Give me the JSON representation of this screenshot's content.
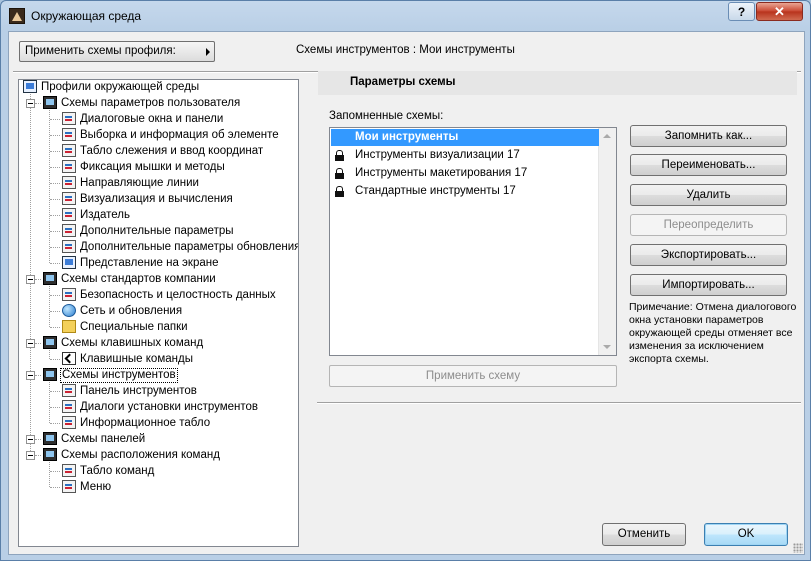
{
  "window": {
    "title": "Окружающая среда",
    "help_label": "?",
    "close_label": "✕"
  },
  "header": {
    "profile_button": "Применить схемы профиля:",
    "current_label": "Схемы инструментов : Мои инструменты"
  },
  "tree": {
    "root": "Профили окружающей среды",
    "groups": [
      {
        "label": "Схемы параметров пользователя",
        "children": [
          "Диалоговые окна и панели",
          "Выборка и информация об элементе",
          "Табло слежения и ввод координат",
          "Фиксация мышки и методы",
          "Направляющие линии",
          "Визуализация и вычисления",
          "Издатель",
          "Дополнительные параметры",
          "Дополнительные параметры обновления",
          "Представление на экране"
        ]
      },
      {
        "label": "Схемы стандартов компании",
        "children": [
          "Безопасность и целостность данных",
          "Сеть и обновления",
          "Специальные папки"
        ]
      },
      {
        "label": "Схемы клавишных команд",
        "children": [
          "Клавишные команды"
        ]
      },
      {
        "label": "Схемы инструментов",
        "children": [
          "Панель инструментов",
          "Диалоги установки инструментов",
          "Информационное табло"
        ]
      },
      {
        "label": "Схемы панелей",
        "children": []
      },
      {
        "label": "Схемы расположения команд",
        "children": [
          "Табло команд",
          "Меню"
        ]
      }
    ],
    "selected": "Схемы инструментов"
  },
  "panel": {
    "heading": "Параметры схемы",
    "saved_label": "Запомненные схемы:",
    "schemes": [
      {
        "label": "Мои инструменты",
        "locked": false,
        "selected": true
      },
      {
        "label": "Инструменты визуализации 17",
        "locked": true,
        "selected": false
      },
      {
        "label": "Инструменты макетирования 17",
        "locked": true,
        "selected": false
      },
      {
        "label": "Стандартные инструменты 17",
        "locked": true,
        "selected": false
      }
    ],
    "apply_button": "Применить схему",
    "buttons": {
      "save_as": "Запомнить как...",
      "rename": "Переименовать...",
      "delete": "Удалить",
      "redefine": "Переопределить",
      "export": "Экспортировать...",
      "import": "Импортировать..."
    },
    "note": "Примечание: Отмена диалогового окна установки параметров окружающей среды отменяет все изменения за исключением экспорта схемы."
  },
  "footer": {
    "cancel": "Отменить",
    "ok": "OK"
  }
}
